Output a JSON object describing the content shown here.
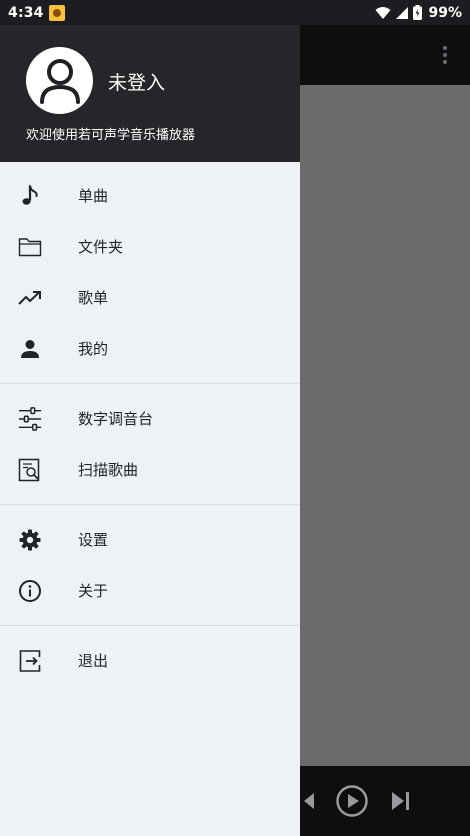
{
  "status_bar": {
    "time": "4:34",
    "battery": "99%"
  },
  "drawer": {
    "header": {
      "username": "未登入",
      "welcome": "欢迎使用若可声学音乐播放器"
    },
    "groups": [
      [
        {
          "id": "songs",
          "label": "单曲",
          "icon": "music-note-icon"
        },
        {
          "id": "folder",
          "label": "文件夹",
          "icon": "folder-icon"
        },
        {
          "id": "playlist",
          "label": "歌单",
          "icon": "trending-up-icon"
        },
        {
          "id": "mine",
          "label": "我的",
          "icon": "person-icon"
        }
      ],
      [
        {
          "id": "equalizer",
          "label": "数字调音台",
          "icon": "sliders-icon"
        },
        {
          "id": "scan",
          "label": "扫描歌曲",
          "icon": "scan-document-icon"
        }
      ],
      [
        {
          "id": "settings",
          "label": "设置",
          "icon": "gear-icon"
        },
        {
          "id": "about",
          "label": "关于",
          "icon": "info-icon"
        }
      ],
      [
        {
          "id": "exit",
          "label": "退出",
          "icon": "exit-icon"
        }
      ]
    ]
  },
  "colors": {
    "header_bg": "#25252a",
    "drawer_bg": "#eef2f6",
    "scrim": "#6b6b6b",
    "toolbar": "#0e0e11"
  }
}
